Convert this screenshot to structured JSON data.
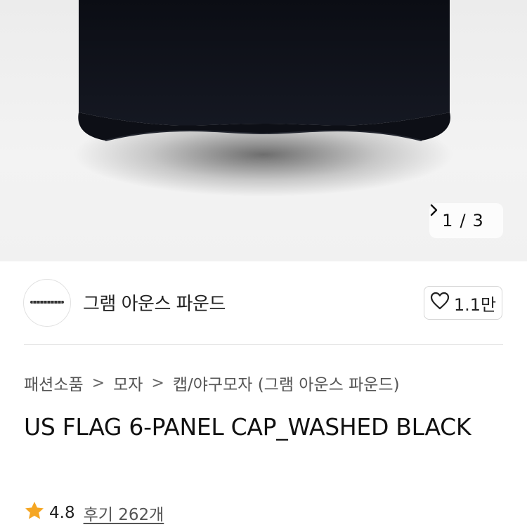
{
  "gallery": {
    "current": "1",
    "separator": "/",
    "total": "3",
    "next_icon": "chevron-right-icon"
  },
  "store": {
    "name": "그램 아운스 파운드",
    "likes": "1.1만",
    "like_icon": "heart-outline-icon"
  },
  "breadcrumb": {
    "items": [
      "패션소품",
      "모자",
      "캡/야구모자 (그램 아운스 파운드)"
    ],
    "separator": ">"
  },
  "product": {
    "title": "US FLAG 6-PANEL CAP_WASHED BLACK",
    "rating": "4.8",
    "reviews": "후기 262개",
    "star_color": "#F5A623"
  }
}
